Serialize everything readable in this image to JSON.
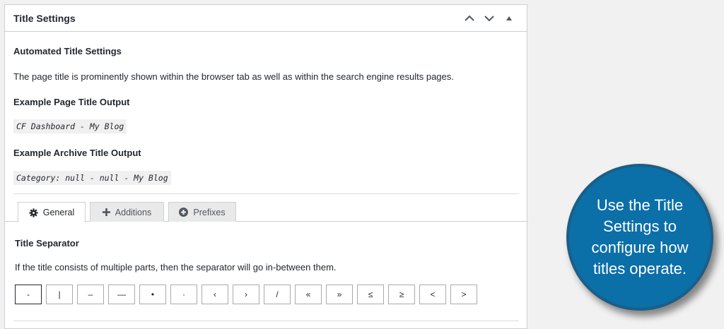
{
  "panel": {
    "title": "Title Settings",
    "controls": [
      "chevron-up",
      "chevron-down",
      "collapse-triangle"
    ]
  },
  "automated": {
    "heading": "Automated Title Settings",
    "description": "The page title is prominently shown within the browser tab as well as within the search engine results pages."
  },
  "example_page": {
    "heading": "Example Page Title Output",
    "value": "CF Dashboard - My Blog"
  },
  "example_archive": {
    "heading": "Example Archive Title Output",
    "value": "Category: null - null - My Blog"
  },
  "tabs": [
    {
      "label": "General",
      "icon": "gear-icon",
      "active": true
    },
    {
      "label": "Additions",
      "icon": "plus-icon",
      "active": false
    },
    {
      "label": "Prefixes",
      "icon": "plus-circle-icon",
      "active": false
    }
  ],
  "separator": {
    "heading": "Title Separator",
    "description": "If the title consists of multiple parts, then the separator will go in-between them.",
    "options": [
      "-",
      "|",
      "–",
      "—",
      "•",
      "·",
      "‹",
      "›",
      "/",
      "«",
      "»",
      "≤",
      "≥",
      "<",
      ">"
    ],
    "selected_index": 0
  },
  "callout": {
    "text": "Use the Title Settings to configure how titles operate."
  },
  "colors": {
    "callout_bg": "#0b6fa8",
    "panel_border": "#ccd0d4"
  }
}
